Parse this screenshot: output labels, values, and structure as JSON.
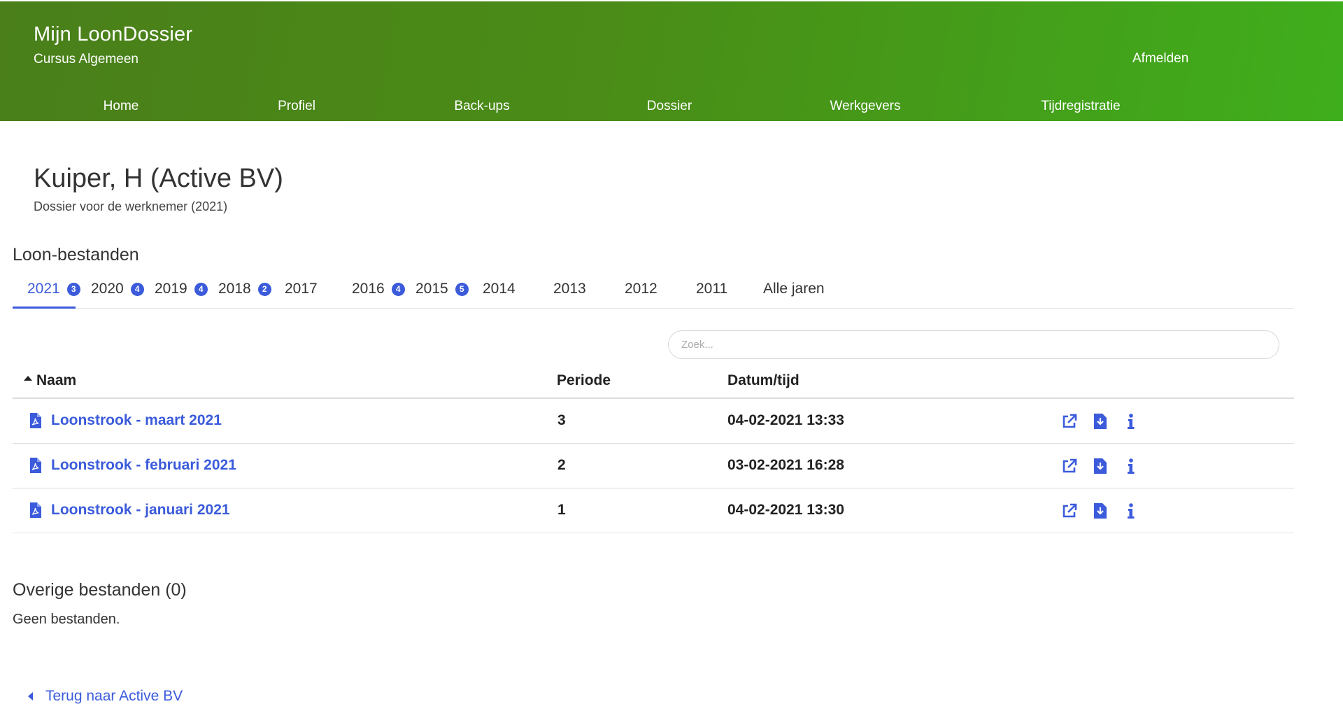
{
  "header": {
    "app_title": "Mijn LoonDossier",
    "subtitle": "Cursus Algemeen",
    "logout": "Afmelden",
    "nav": [
      "Home",
      "Profiel",
      "Back-ups",
      "Dossier",
      "Werkgevers",
      "Tijdregistratie"
    ]
  },
  "page": {
    "title": "Kuiper, H (Active BV)",
    "subtitle": "Dossier voor de werknemer (2021)"
  },
  "loon": {
    "section_title": "Loon-bestanden",
    "tabs": [
      {
        "label": "2021",
        "badge": "3",
        "active": true
      },
      {
        "label": "2020",
        "badge": "4"
      },
      {
        "label": "2019",
        "badge": "4"
      },
      {
        "label": "2018",
        "badge": "2"
      },
      {
        "label": "2017",
        "badge": ""
      },
      {
        "label": "2016",
        "badge": "4"
      },
      {
        "label": "2015",
        "badge": "5"
      },
      {
        "label": "2014",
        "badge": ""
      },
      {
        "label": "2013",
        "badge": ""
      },
      {
        "label": "2012",
        "badge": ""
      },
      {
        "label": "2011",
        "badge": ""
      },
      {
        "label": "Alle jaren",
        "badge": ""
      }
    ],
    "search_placeholder": "Zoek...",
    "columns": {
      "name": "Naam",
      "period": "Periode",
      "datetime": "Datum/tijd"
    },
    "rows": [
      {
        "name": "Loonstrook - maart 2021",
        "period": "3",
        "datetime": "04-02-2021 13:33"
      },
      {
        "name": "Loonstrook - februari 2021",
        "period": "2",
        "datetime": "03-02-2021 16:28"
      },
      {
        "name": "Loonstrook - januari 2021",
        "period": "1",
        "datetime": "04-02-2021 13:30"
      }
    ]
  },
  "overige": {
    "section_title": "Overige bestanden (0)",
    "empty_text": "Geen bestanden."
  },
  "back_link": "Terug naar Active BV",
  "colors": {
    "accent": "#3b5bdb",
    "header_start": "#4a7f1a",
    "header_end": "#3fae1c"
  },
  "icons": {
    "file": "file-pdf-icon",
    "open": "external-link-icon",
    "download": "file-download-icon",
    "info": "info-icon",
    "sort": "sort-up-icon",
    "back": "caret-left-icon"
  }
}
